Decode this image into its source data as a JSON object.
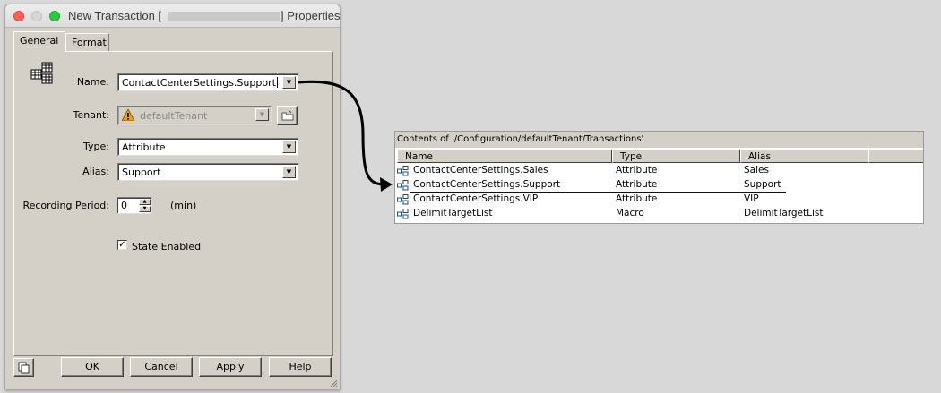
{
  "window": {
    "title_prefix": "New Transaction [",
    "title_suffix": "] Properties"
  },
  "tabs": [
    "General",
    "Format"
  ],
  "form": {
    "name_label": "Name:",
    "name_value": "ContactCenterSettings.Support",
    "tenant_label": "Tenant:",
    "tenant_value": "defaultTenant",
    "type_label": "Type:",
    "type_value": "Attribute",
    "alias_label": "Alias:",
    "alias_value": "Support",
    "recording_label": "Recording Period:",
    "recording_value": "0",
    "recording_unit": "(min)",
    "state_label": "State Enabled",
    "state_checked": true
  },
  "buttons": {
    "ok": "OK",
    "cancel": "Cancel",
    "apply": "Apply",
    "help": "Help"
  },
  "contents_table": {
    "caption": "Contents of '/Configuration/defaultTenant/Transactions'",
    "columns": [
      "Name",
      "Type",
      "Alias"
    ],
    "rows": [
      {
        "name": "ContactCenterSettings.Sales",
        "type": "Attribute",
        "alias": "Sales"
      },
      {
        "name": "ContactCenterSettings.Support",
        "type": "Attribute",
        "alias": "Support"
      },
      {
        "name": "ContactCenterSettings.VIP",
        "type": "Attribute",
        "alias": "VIP"
      },
      {
        "name": "DelimitTargetList",
        "type": "Macro",
        "alias": "DelimitTargetList"
      }
    ]
  },
  "colors": {
    "dialog_bg": "#d4d0c8",
    "page_bg": "#d8d8d8",
    "close": "#fd5f57",
    "maximize": "#2bc840",
    "tenant_warning": "#e8a317"
  }
}
